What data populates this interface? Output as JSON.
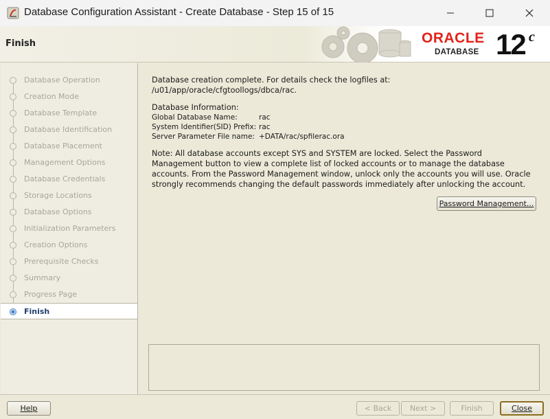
{
  "window": {
    "title": "Database Configuration Assistant - Create Database - Step 15 of 15"
  },
  "header": {
    "title": "Finish",
    "brand": "ORACLE",
    "product": "DATABASE",
    "version": "12",
    "version_sup": "c"
  },
  "nav": {
    "items": [
      {
        "label": "Database Operation"
      },
      {
        "label": "Creation Mode"
      },
      {
        "label": "Database Template"
      },
      {
        "label": "Database Identification"
      },
      {
        "label": "Database Placement"
      },
      {
        "label": "Management Options"
      },
      {
        "label": "Database Credentials"
      },
      {
        "label": "Storage Locations"
      },
      {
        "label": "Database Options"
      },
      {
        "label": "Initialization Parameters"
      },
      {
        "label": "Creation Options"
      },
      {
        "label": "Prerequisite Checks"
      },
      {
        "label": "Summary"
      },
      {
        "label": "Progress Page"
      },
      {
        "label": "Finish"
      }
    ],
    "active": "Finish"
  },
  "main": {
    "complete_line1": "Database creation complete. For details check the logfiles at:",
    "complete_line2": " /u01/app/oracle/cfgtoollogs/dbca/rac.",
    "info_heading": "Database Information:",
    "info": [
      {
        "label": "Global Database Name:",
        "value": "rac"
      },
      {
        "label": "System Identifier(SID) Prefix:",
        "value": "rac"
      },
      {
        "label": "Server Parameter File name:",
        "value": "+DATA/rac/spfilerac.ora"
      }
    ],
    "note_lines": [
      "Note: All database accounts except SYS and SYSTEM are locked. Select the Password",
      "Management button to view a complete list of locked accounts or to manage the database",
      "accounts. From the Password Management window, unlock only the accounts you will use. Oracle",
      "strongly recommends changing the default passwords immediately after unlocking the account."
    ],
    "password_button_label": "Password Management..."
  },
  "footer": {
    "help_label": "Help",
    "back_label": "< Back",
    "next_label": "Next >",
    "finish_label": "Finish",
    "close_label": "Close"
  },
  "colors": {
    "oracle_red": "#e2231a",
    "active_nav_text": "#1f3f6e",
    "background": "#ece9d8"
  }
}
